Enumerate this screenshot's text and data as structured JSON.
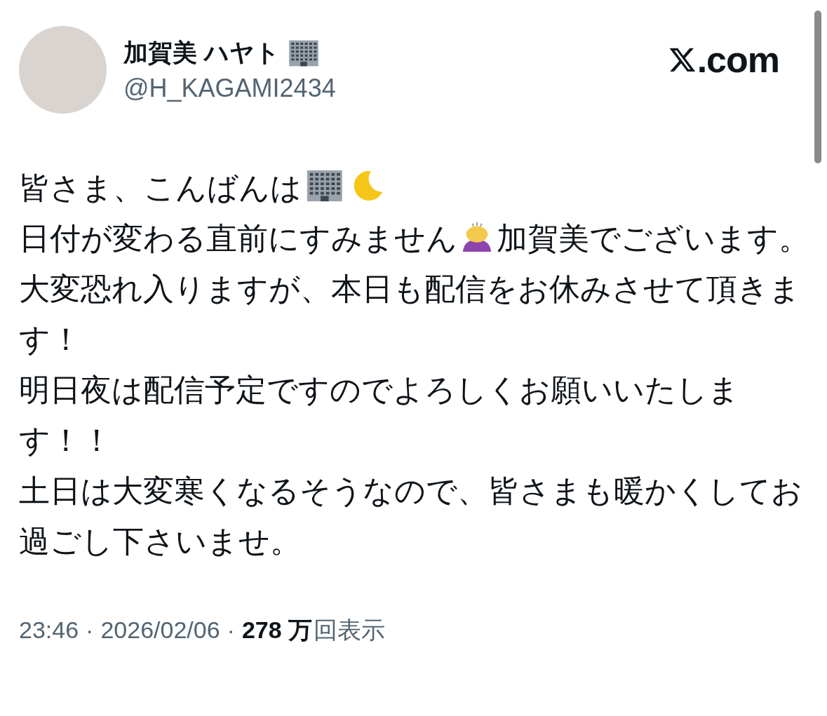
{
  "author": {
    "name": "加賀美 ハヤト",
    "name_emoji": {
      "kind": "building"
    },
    "handle": "@H_KAGAMI2434"
  },
  "brand": {
    "suffix": ".com"
  },
  "body": [
    [
      {
        "kind": "text",
        "text": "皆さま、こんばんは"
      },
      {
        "kind": "building"
      },
      {
        "kind": "moon"
      }
    ],
    [
      {
        "kind": "text",
        "text": "日付が変わる直前にすみません"
      },
      {
        "kind": "bowing"
      },
      {
        "kind": "text",
        "text": "加賀美でございます。"
      }
    ],
    [
      {
        "kind": "text",
        "text": "大変恐れ入りますが、本日も配信をお休みさせて頂きます！"
      }
    ],
    [
      {
        "kind": "text",
        "text": "明日夜は配信予定ですのでよろしくお願いいたします！！"
      }
    ],
    [
      {
        "kind": "text",
        "text": "土日は大変寒くなるそうなので、皆さまも暖かくしてお過ごし下さいませ。"
      }
    ]
  ],
  "footer": {
    "time": "23:46",
    "separators": [
      "·",
      "·"
    ],
    "date": "2026/02/06",
    "views_count": "278 万",
    "views_label": "回表示"
  }
}
